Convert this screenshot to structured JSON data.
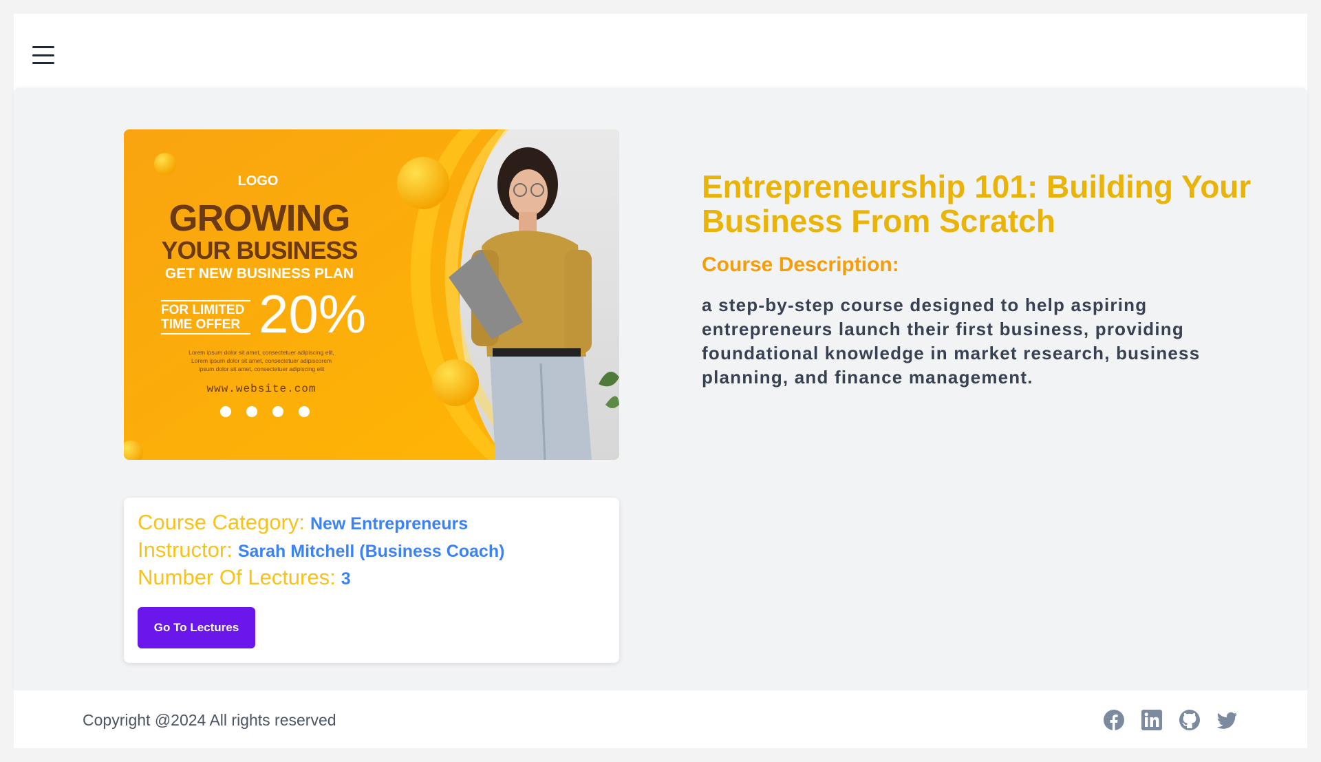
{
  "nav": {
    "menu_icon": "hamburger-menu-icon"
  },
  "banner": {
    "logo": "LOGO",
    "headline_1": "GROWING",
    "headline_2": "YOUR BUSINESS",
    "headline_3": "GET NEW BUSINESS PLAN",
    "offer_line_1": "FOR LIMITED",
    "offer_line_2": "TIME OFFER",
    "discount": "20%",
    "body_lines": [
      "Lorem ipsum dolor sit amet, consectetuer adipiscing elit,",
      "Lorem ipsum dolor sit amet, consectetuer adipiscorem",
      "ipsum dolor sit amet, consectetuer adipiscing elit"
    ],
    "website": "www.website.com",
    "colors": {
      "orange": "#fba909",
      "dark_brown": "#6b3a12",
      "yellow_ball": "#ffc400"
    }
  },
  "course": {
    "title": "Entrepreneurship 101: Building Your Business From Scratch",
    "description_heading": "Course Description:",
    "description": "a step-by-step course designed to help aspiring entrepreneurs launch their first business, providing foundational knowledge in market research, business planning, and finance management."
  },
  "info": {
    "category_label": "Course Category:",
    "category_value": "New Entrepreneurs",
    "instructor_label": "Instructor:",
    "instructor_value": "Sarah Mitchell (Business Coach)",
    "lectures_label": "Number Of Lectures:",
    "lectures_value": "3",
    "button_label": "Go To Lectures"
  },
  "footer": {
    "copyright": "Copyright @2024 All rights reserved",
    "social_icons": [
      "facebook-icon",
      "linkedin-icon",
      "github-icon",
      "twitter-icon"
    ]
  },
  "colors": {
    "title_yellow": "#eab308",
    "heading_orange": "#f59e0b",
    "label_yellow": "#f9c21b",
    "value_blue": "#3b82f6",
    "button_purple": "#6b17ec",
    "icon_gray": "#7b8a9e"
  }
}
